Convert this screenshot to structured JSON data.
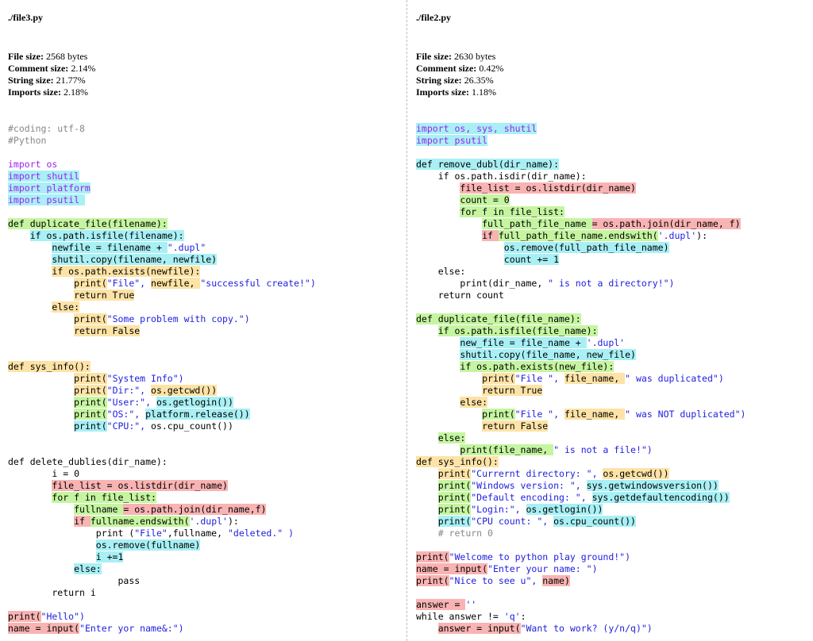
{
  "left": {
    "filename": "./file3.py",
    "stats": [
      {
        "label": "File size:",
        "value": "2568 bytes"
      },
      {
        "label": "Comment size:",
        "value": "2.14%"
      },
      {
        "label": "String size:",
        "value": "21.77%"
      },
      {
        "label": "Imports size:",
        "value": "2.18%"
      }
    ],
    "lines": [
      [
        {
          "t": "#coding: utf-8",
          "c": "cm"
        }
      ],
      [
        {
          "t": "#Python",
          "c": "cm"
        }
      ],
      [],
      [
        {
          "t": "import os",
          "c": "kw"
        }
      ],
      [
        {
          "t": "import shutil",
          "c": "kw",
          "h": "blue"
        }
      ],
      [
        {
          "t": "import platform",
          "c": "kw",
          "h": "blue"
        }
      ],
      [
        {
          "t": "import psutil ",
          "c": "kw",
          "h": "blue"
        }
      ],
      [],
      [
        {
          "t": "def duplicate_file(filename):",
          "h": "green"
        }
      ],
      [
        {
          "t": "    "
        },
        {
          "t": "if os.path.isfile(filename):",
          "h": "blue"
        }
      ],
      [
        {
          "t": "        "
        },
        {
          "t": "newfile = filename + ",
          "h": "blue"
        },
        {
          "t": "\".dupl\"",
          "c": "str"
        }
      ],
      [
        {
          "t": "        "
        },
        {
          "t": "shutil.copy(filename, newfile)",
          "h": "blue"
        }
      ],
      [
        {
          "t": "        "
        },
        {
          "t": "if os.path.exists(newfile):",
          "h": "yellow"
        }
      ],
      [
        {
          "t": "            "
        },
        {
          "t": "print(",
          "h": "yellow"
        },
        {
          "t": "\"File\", ",
          "c": "str"
        },
        {
          "t": "newfile, ",
          "h": "yellow"
        },
        {
          "t": "\"successful create!\")",
          "c": "str"
        }
      ],
      [
        {
          "t": "            "
        },
        {
          "t": "return True",
          "h": "yellow"
        }
      ],
      [
        {
          "t": "        "
        },
        {
          "t": "else:",
          "h": "yellow"
        }
      ],
      [
        {
          "t": "            "
        },
        {
          "t": "print(",
          "h": "yellow"
        },
        {
          "t": "\"Some problem with copy.\")",
          "c": "str"
        }
      ],
      [
        {
          "t": "            "
        },
        {
          "t": "return False",
          "h": "yellow"
        }
      ],
      [],
      [],
      [
        {
          "t": "def sys_info():",
          "h": "yellow"
        }
      ],
      [
        {
          "t": "            "
        },
        {
          "t": "print(",
          "h": "yellow"
        },
        {
          "t": "\"System Info\")",
          "c": "str"
        }
      ],
      [
        {
          "t": "            "
        },
        {
          "t": "print(",
          "h": "yellow"
        },
        {
          "t": "\"Dir:\", ",
          "c": "str"
        },
        {
          "t": "os.getcwd())",
          "h": "yellow"
        }
      ],
      [
        {
          "t": "            "
        },
        {
          "t": "print(",
          "h": "green"
        },
        {
          "t": "\"User:\", ",
          "c": "str"
        },
        {
          "t": "os.getlogin())",
          "h": "blue"
        }
      ],
      [
        {
          "t": "            "
        },
        {
          "t": "print(",
          "h": "green"
        },
        {
          "t": "\"OS:\", ",
          "c": "str"
        },
        {
          "t": "platform.release())",
          "h": "blue"
        }
      ],
      [
        {
          "t": "            "
        },
        {
          "t": "print(",
          "h": "blue"
        },
        {
          "t": "\"CPU:\", ",
          "c": "str"
        },
        {
          "t": "os.cpu_count())"
        }
      ],
      [],
      [],
      [
        {
          "t": "def delete_dublies(dir_name):"
        }
      ],
      [
        {
          "t": "        i = 0"
        }
      ],
      [
        {
          "t": "        "
        },
        {
          "t": "file_list = os.listdir(dir_name)",
          "h": "red"
        }
      ],
      [
        {
          "t": "        "
        },
        {
          "t": "for f in file_list:",
          "h": "green"
        }
      ],
      [
        {
          "t": "            "
        },
        {
          "t": "fullname ",
          "h": "green"
        },
        {
          "t": "= os.path.join(dir_name,f)",
          "h": "red"
        }
      ],
      [
        {
          "t": "            "
        },
        {
          "t": "if ",
          "h": "red"
        },
        {
          "t": "fullname.endswith(",
          "h": "green"
        },
        {
          "t": "'.dupl'",
          "c": "str"
        },
        {
          "t": "):"
        }
      ],
      [
        {
          "t": "                print (",
          "h": ""
        },
        {
          "t": "\"File\"",
          "c": "str"
        },
        {
          "t": ",fullname, "
        },
        {
          "t": "\"deleted.\" )",
          "c": "str"
        }
      ],
      [
        {
          "t": "                "
        },
        {
          "t": "os.remove(fullname)",
          "h": "blue"
        }
      ],
      [
        {
          "t": "                "
        },
        {
          "t": "i +=1",
          "h": "blue"
        }
      ],
      [
        {
          "t": "            "
        },
        {
          "t": "else:",
          "h": "blue"
        }
      ],
      [
        {
          "t": "                    pass"
        }
      ],
      [
        {
          "t": "        return i"
        }
      ],
      [],
      [
        {
          "t": "print(",
          "h": "red"
        },
        {
          "t": "\"Hello\")",
          "c": "str"
        }
      ],
      [
        {
          "t": "name = input(",
          "h": "red"
        },
        {
          "t": "\"Enter yor name&:\")",
          "c": "str"
        }
      ]
    ]
  },
  "right": {
    "filename": "./file2.py",
    "stats": [
      {
        "label": "File size:",
        "value": "2630 bytes"
      },
      {
        "label": "Comment size:",
        "value": "0.42%"
      },
      {
        "label": "String size:",
        "value": "26.35%"
      },
      {
        "label": "Imports size:",
        "value": "1.18%"
      }
    ],
    "lines": [
      [
        {
          "t": "import os, sys, shutil",
          "c": "kw",
          "h": "blue"
        }
      ],
      [
        {
          "t": "import psutil",
          "c": "kw",
          "h": "blue"
        }
      ],
      [],
      [
        {
          "t": "def remove_dubl(dir_name):",
          "h": "blue"
        }
      ],
      [
        {
          "t": "    if os.path.isdir(dir_name):"
        }
      ],
      [
        {
          "t": "        "
        },
        {
          "t": "file_list = os.listdir(dir_name)",
          "h": "red"
        }
      ],
      [
        {
          "t": "        "
        },
        {
          "t": "count = 0",
          "h": "green"
        }
      ],
      [
        {
          "t": "        "
        },
        {
          "t": "for f in file_list:",
          "h": "green"
        }
      ],
      [
        {
          "t": "            "
        },
        {
          "t": "full_path_file_name ",
          "h": "green"
        },
        {
          "t": "= os.path.join(dir_name, f)",
          "h": "red"
        }
      ],
      [
        {
          "t": "            "
        },
        {
          "t": "if ",
          "h": "red"
        },
        {
          "t": "full_path_file_name.endswith(",
          "h": "green"
        },
        {
          "t": "'.dupl'",
          "c": "str"
        },
        {
          "t": "):"
        }
      ],
      [
        {
          "t": "                "
        },
        {
          "t": "os.remove(full_path_file_name)",
          "h": "blue"
        }
      ],
      [
        {
          "t": "                "
        },
        {
          "t": "count += 1",
          "h": "blue"
        }
      ],
      [
        {
          "t": "    else:"
        }
      ],
      [
        {
          "t": "        print(dir_name, "
        },
        {
          "t": "\" is not a directory!\")",
          "c": "str"
        }
      ],
      [
        {
          "t": "    return count"
        }
      ],
      [],
      [
        {
          "t": "def duplicate_file(file_name):",
          "h": "green"
        }
      ],
      [
        {
          "t": "    "
        },
        {
          "t": "if os.path.isfile(file_name):",
          "h": "green"
        }
      ],
      [
        {
          "t": "        "
        },
        {
          "t": "new_file = file_name + ",
          "h": "blue"
        },
        {
          "t": "'.dupl'",
          "c": "str"
        }
      ],
      [
        {
          "t": "        "
        },
        {
          "t": "shutil.copy(file_name, new_file)",
          "h": "blue"
        }
      ],
      [
        {
          "t": "        "
        },
        {
          "t": "if os.path.exists(new_file):",
          "h": "green"
        }
      ],
      [
        {
          "t": "            "
        },
        {
          "t": "print(",
          "h": "yellow"
        },
        {
          "t": "\"File \", ",
          "c": "str"
        },
        {
          "t": "file_name, ",
          "h": "yellow"
        },
        {
          "t": "\" was duplicated\")",
          "c": "str"
        }
      ],
      [
        {
          "t": "            "
        },
        {
          "t": "return True",
          "h": "yellow"
        }
      ],
      [
        {
          "t": "        "
        },
        {
          "t": "else:",
          "h": "yellow"
        }
      ],
      [
        {
          "t": "            "
        },
        {
          "t": "print(",
          "h": "green"
        },
        {
          "t": "\"File \", ",
          "c": "str"
        },
        {
          "t": "file_name, ",
          "h": "yellow"
        },
        {
          "t": "\" was NOT duplicated\")",
          "c": "str"
        }
      ],
      [
        {
          "t": "            "
        },
        {
          "t": "return False",
          "h": "yellow"
        }
      ],
      [
        {
          "t": "    "
        },
        {
          "t": "else:",
          "h": "green"
        }
      ],
      [
        {
          "t": "        "
        },
        {
          "t": "print(file_name, ",
          "h": "green"
        },
        {
          "t": "\" is not a file!\")",
          "c": "str"
        }
      ],
      [
        {
          "t": "def sys_info():",
          "h": "yellow"
        }
      ],
      [
        {
          "t": "    "
        },
        {
          "t": "print(",
          "h": "yellow"
        },
        {
          "t": "\"Currernt directory: \", ",
          "c": "str"
        },
        {
          "t": "os.getcwd())",
          "h": "yellow"
        }
      ],
      [
        {
          "t": "    "
        },
        {
          "t": "print(",
          "h": "green"
        },
        {
          "t": "\"Windows version: \", ",
          "c": "str"
        },
        {
          "t": "sys.getwindowsversion())",
          "h": "blue"
        }
      ],
      [
        {
          "t": "    "
        },
        {
          "t": "print(",
          "h": "green"
        },
        {
          "t": "\"Default encoding: \", ",
          "c": "str"
        },
        {
          "t": "sys.getdefaultencoding())",
          "h": "blue"
        }
      ],
      [
        {
          "t": "    "
        },
        {
          "t": "print(",
          "h": "green"
        },
        {
          "t": "\"Login:\", ",
          "c": "str"
        },
        {
          "t": "os.getlogin())",
          "h": "blue"
        }
      ],
      [
        {
          "t": "    "
        },
        {
          "t": "print(",
          "h": "blue"
        },
        {
          "t": "\"CPU count: \", ",
          "c": "str"
        },
        {
          "t": "os.cpu_count())",
          "h": "blue"
        }
      ],
      [
        {
          "t": "    "
        },
        {
          "t": "# return 0",
          "c": "cm"
        }
      ],
      [],
      [
        {
          "t": "print(",
          "h": "red"
        },
        {
          "t": "\"Welcome to python play ground!\")",
          "c": "str"
        }
      ],
      [
        {
          "t": "name = input(",
          "h": "red"
        },
        {
          "t": "\"Enter your name: \")",
          "c": "str"
        }
      ],
      [
        {
          "t": "print(",
          "h": "red"
        },
        {
          "t": "\"Nice to see u\", ",
          "c": "str"
        },
        {
          "t": "name)",
          "h": "red"
        }
      ],
      [],
      [
        {
          "t": "answer = ",
          "h": "red"
        },
        {
          "t": "''",
          "c": "str"
        }
      ],
      [
        {
          "t": "while answer != "
        },
        {
          "t": "'q'",
          "c": "str"
        },
        {
          "t": ":"
        }
      ],
      [
        {
          "t": "    "
        },
        {
          "t": "answer = input(",
          "h": "red"
        },
        {
          "t": "\"Want to work? (y/n/q)\")",
          "c": "str"
        }
      ]
    ]
  }
}
